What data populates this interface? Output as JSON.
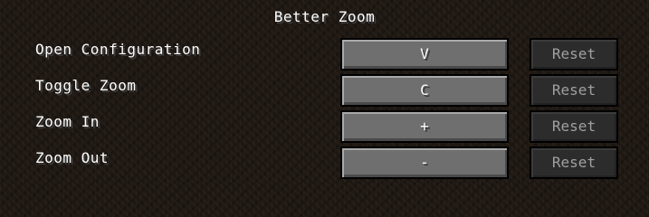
{
  "screen": {
    "title": "Better Zoom"
  },
  "keybindings": [
    {
      "action": "Open Configuration",
      "key": "V",
      "reset_label": "Reset"
    },
    {
      "action": "Toggle Zoom",
      "key": "C",
      "reset_label": "Reset"
    },
    {
      "action": "Zoom In",
      "key": "+",
      "reset_label": "Reset"
    },
    {
      "action": "Zoom Out",
      "key": "-",
      "reset_label": "Reset"
    }
  ]
}
